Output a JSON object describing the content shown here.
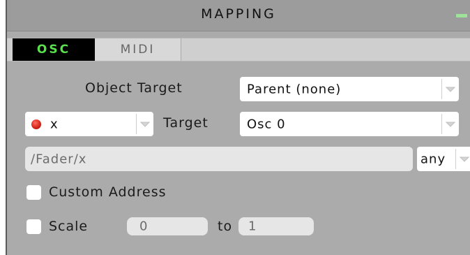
{
  "window": {
    "title": "MAPPING"
  },
  "tabs": [
    {
      "label": "OSC",
      "active": true
    },
    {
      "label": "MIDI",
      "active": false
    }
  ],
  "object_target": {
    "label": "Object Target",
    "value": "Parent (none)"
  },
  "parameter": {
    "value": "x",
    "status_color": "#d7261a"
  },
  "target": {
    "label": "Target",
    "value": "Osc 0"
  },
  "address": {
    "value": "/Fader/x"
  },
  "type_tag": {
    "value": "any"
  },
  "custom_address": {
    "label": "Custom Address",
    "checked": false
  },
  "scale": {
    "label": "Scale",
    "checked": false,
    "from_value": "0",
    "to_label": "to",
    "to_value": "1"
  },
  "colors": {
    "panel_background": "#ababab",
    "active_tab_text": "#59e04c",
    "active_tab_background": "#000000",
    "title_indicator": "#9ee39a"
  }
}
